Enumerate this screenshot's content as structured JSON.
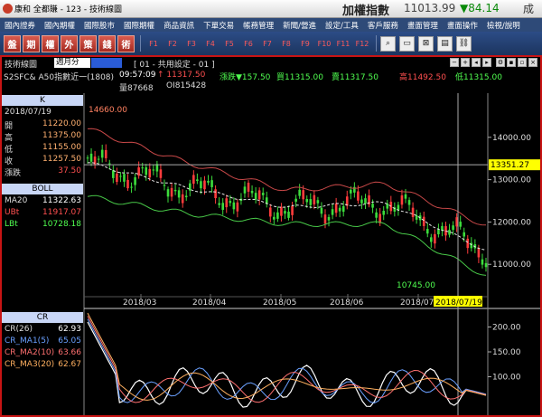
{
  "titlebar": {
    "app_title": "康和 全都賺 - 123 - 技術線圖",
    "index_name": "加權指數",
    "index_value": "11013.99",
    "index_change": "▼84.14",
    "volume_label": "成交"
  },
  "menu": [
    "國內證券",
    "國內期權",
    "國際股市",
    "國際期權",
    "商品資訊",
    "下單交易",
    "帳務管理",
    "新聞/營進",
    "設定/工具",
    "客戶服務",
    "畫面管理",
    "畫面操作",
    "檢視/說明"
  ],
  "toolbar": {
    "buttons": [
      "盤",
      "期",
      "權",
      "外",
      "策",
      "錢",
      "術"
    ],
    "fkeys": [
      "F1",
      "F2",
      "F3",
      "F4",
      "F5",
      "F6",
      "F7",
      "F8",
      "F9",
      "F10",
      "F11",
      "F12"
    ],
    "icons": [
      "search-icon",
      "window-icon",
      "grid-icon",
      "print-icon",
      "link-icon"
    ]
  },
  "chart_header": {
    "title": "技術線圖",
    "period": "週月分",
    "setting": "[ 01 - 共用設定 - 01 ]",
    "symbol": "S2SFC& A50指數近一(1808)",
    "time": "09:57:09",
    "last_price": "↑ 11317.50",
    "change": "漲跌▼157.50",
    "bid": "買11315.00",
    "ask": "賣11317.50",
    "high": "高11492.50",
    "low": "低11315.00",
    "volume": "量87668",
    "oi": "OI815428"
  },
  "k_panel": {
    "title": "K",
    "date": "2018/07/19",
    "rows": [
      {
        "label": "開",
        "value": "11220.00"
      },
      {
        "label": "高",
        "value": "11375.00"
      },
      {
        "label": "低",
        "value": "11155.00"
      },
      {
        "label": "收",
        "value": "11257.50"
      },
      {
        "label": "漲跌",
        "value": "37.50"
      }
    ]
  },
  "boll_panel": {
    "title": "BOLL",
    "rows": [
      {
        "label": "MA20",
        "value": "11322.63",
        "color": "#ffffff"
      },
      {
        "label": "UBt",
        "value": "11917.07",
        "color": "#ff5050"
      },
      {
        "label": "LBt",
        "value": "10728.18",
        "color": "#50ff50"
      }
    ]
  },
  "cr_panel": {
    "title": "CR",
    "rows": [
      {
        "label": "CR(26)",
        "value": "62.93",
        "color": "#ffffff"
      },
      {
        "label": "CR_MA1(5)",
        "value": "65.05",
        "color": "#6aa0ff"
      },
      {
        "label": "CR_MA2(10)",
        "value": "63.66",
        "color": "#ff7070"
      },
      {
        "label": "CR_MA3(20)",
        "value": "62.67",
        "color": "#ffb060"
      }
    ]
  },
  "main_chart": {
    "y_ticks": [
      "14000.00",
      "13000.00",
      "12000.00",
      "11000.00"
    ],
    "x_ticks": [
      "2018/03",
      "2018/04",
      "2018/05",
      "2018/06",
      "2018/07"
    ],
    "cursor_date": "2018/07/19",
    "crosshair_value": "13351.27",
    "high_label": "14660.00",
    "low_label": "10745.00"
  },
  "sub_chart": {
    "y_ticks": [
      "200.00",
      "150.00",
      "100.00"
    ]
  },
  "chart_data": {
    "type": "line",
    "title": "S2SFC& A50指數近一(1808)",
    "ylim": [
      10300,
      15000
    ],
    "x": [
      "2018/03",
      "2018/04",
      "2018/05",
      "2018/06",
      "2018/07"
    ],
    "series": [
      {
        "name": "MA20",
        "values": [
          13400,
          12800,
          12350,
          12450,
          11330
        ]
      },
      {
        "name": "UBt",
        "values": [
          14200,
          13400,
          12750,
          12900,
          11920
        ]
      },
      {
        "name": "LBt",
        "values": [
          12600,
          12200,
          11950,
          11950,
          10730
        ]
      }
    ]
  }
}
